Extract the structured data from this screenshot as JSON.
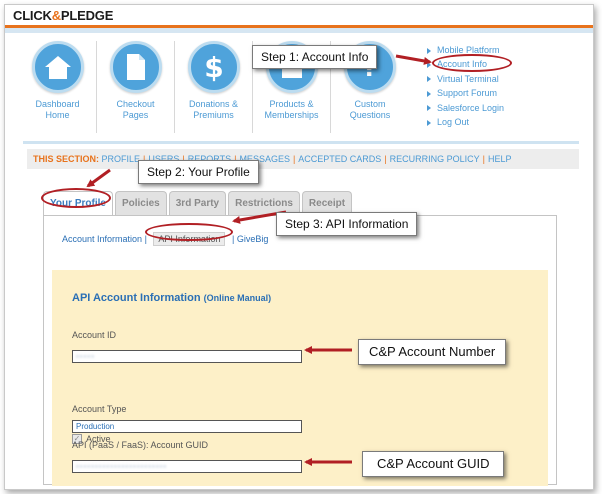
{
  "brand": {
    "left": "CLICK",
    "amp": "&",
    "right": "PLEDGE",
    "accent": "#e8731d",
    "link_color": "#4c9ad4"
  },
  "nav": [
    {
      "label": "Dashboard\nHome",
      "icon": "house-icon"
    },
    {
      "label": "Checkout\nPages",
      "icon": "document-icon"
    },
    {
      "label": "Donations &\nPremiums",
      "icon": "dollar-icon"
    },
    {
      "label": "Products &\nMemberships",
      "icon": "package-icon"
    },
    {
      "label": "Custom\nQuestions",
      "icon": "question-icon"
    }
  ],
  "quick_links": [
    "Mobile Platform",
    "Account Info",
    "Virtual Terminal",
    "Support Forum",
    "Salesforce Login",
    "Log Out"
  ],
  "section": {
    "label": "THIS SECTION:",
    "links": [
      "PROFILE",
      "USERS",
      "REPORTS",
      "MESSAGES",
      "ACCEPTED CARDS",
      "RECURRING POLICY",
      "HELP"
    ]
  },
  "tabs": [
    "Your Profile",
    "Policies",
    "3rd Party",
    "Restrictions",
    "Receipt"
  ],
  "subtabs": [
    "Account Information",
    "API Information",
    "GiveBig"
  ],
  "api": {
    "title": "API Account Information",
    "manual": "(Online Manual)",
    "account_id_label": "Account ID",
    "account_id_value": "•••••",
    "active_label": "Active",
    "account_type_label": "Account Type",
    "account_type_value": "Production",
    "guid_label": "API (PaaS / FaaS): Account GUID",
    "guid_value": "••••••••••••••••••••••••"
  },
  "callouts": {
    "step1": "Step 1: Account Info",
    "step2": "Step 2: Your Profile",
    "step3": "Step 3: API Information",
    "account_number": "C&P Account Number",
    "account_guid": "C&P Account GUID"
  },
  "annotation_color": "#b11f24"
}
